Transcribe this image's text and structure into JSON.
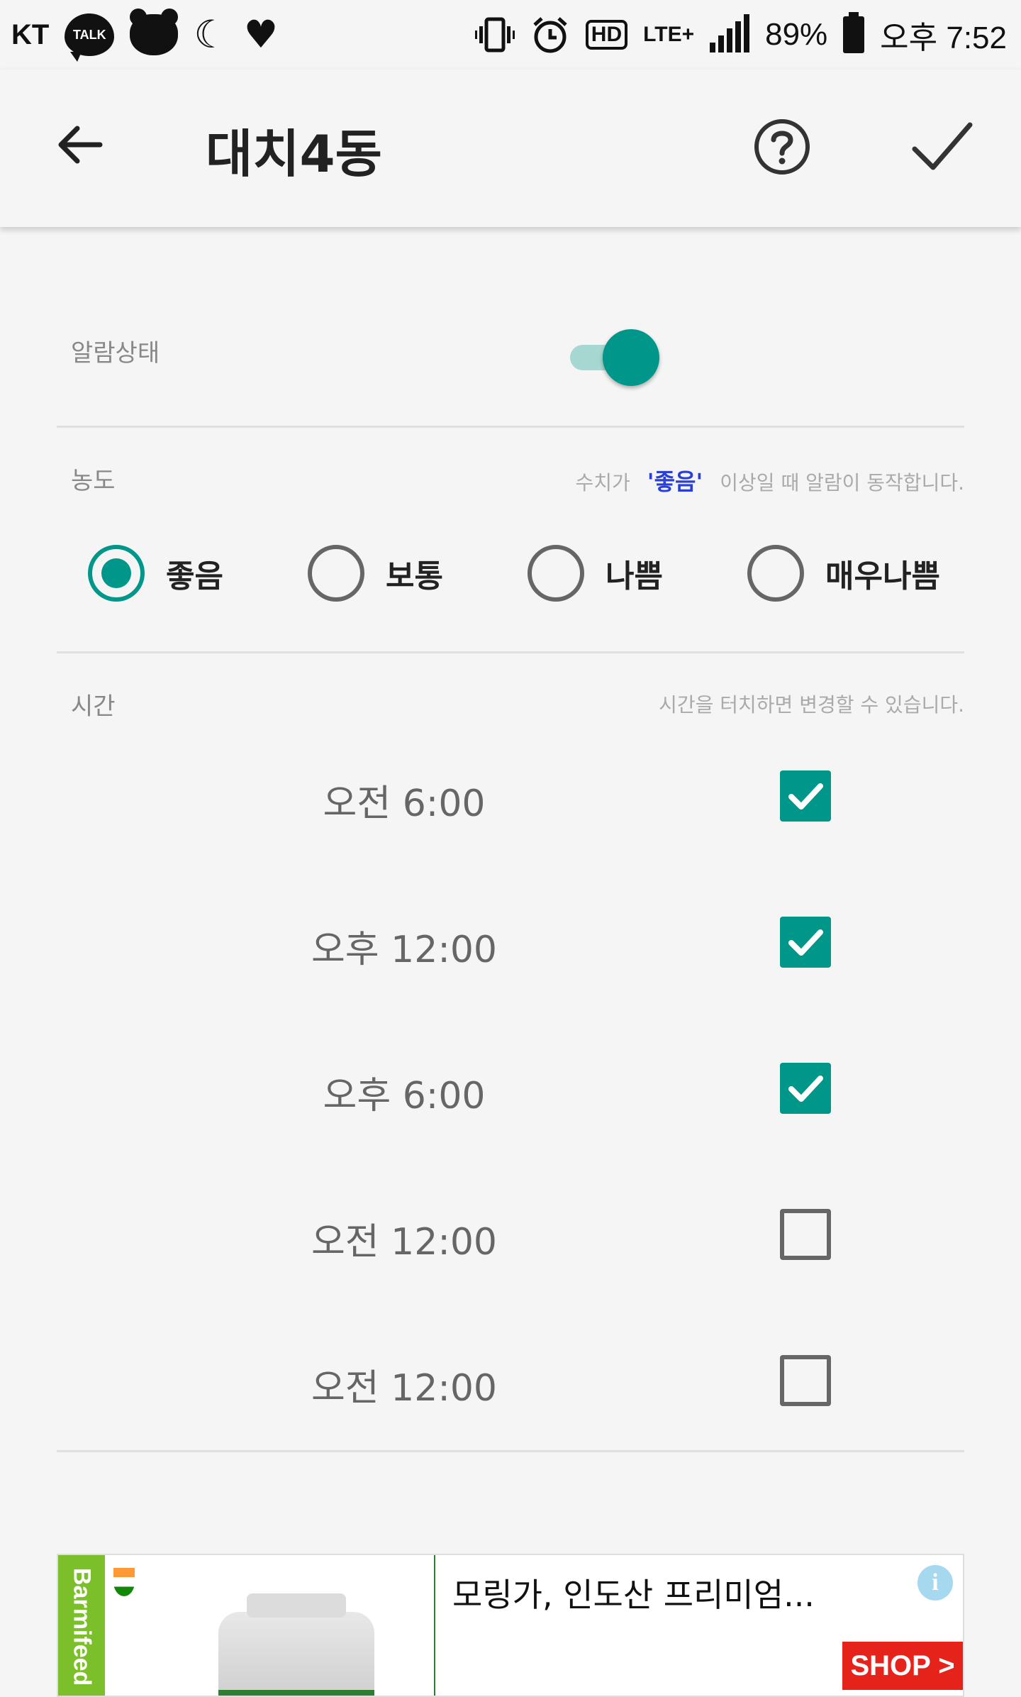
{
  "status_bar": {
    "carrier": "KT",
    "talk_badge": "TALK",
    "hd_label": "HD",
    "network": "LTE+",
    "battery_percent": "89%",
    "time": "오후 7:52",
    "icons": [
      "kakaotalk-icon",
      "bear-icon",
      "moon-icon",
      "heart-icon",
      "vibrate-icon",
      "alarm-clock-icon",
      "hd-icon",
      "lte-icon",
      "signal-icon",
      "battery-icon"
    ]
  },
  "app_bar": {
    "title": "대치4동",
    "icons": [
      "back-arrow-icon",
      "help-icon",
      "check-icon"
    ]
  },
  "alarm": {
    "label": "알람상태",
    "enabled": true
  },
  "concentration": {
    "label": "농도",
    "hint_prefix": "수치가",
    "hint_highlight": "'좋음'",
    "hint_suffix": "이상일 때 알람이 동작합니다.",
    "options": [
      {
        "label": "좋음",
        "selected": true
      },
      {
        "label": "보통",
        "selected": false
      },
      {
        "label": "나쁨",
        "selected": false
      },
      {
        "label": "매우나쁨",
        "selected": false
      }
    ]
  },
  "time": {
    "label": "시간",
    "hint": "시간을 터치하면 변경할 수 있습니다.",
    "rows": [
      {
        "time": "오전 6:00",
        "checked": true
      },
      {
        "time": "오후 12:00",
        "checked": true
      },
      {
        "time": "오후 6:00",
        "checked": true
      },
      {
        "time": "오전 12:00",
        "checked": false
      },
      {
        "time": "오전 12:00",
        "checked": false
      }
    ]
  },
  "ad": {
    "brand": "Barmifeed",
    "text": "모링가, 인도산 프리미엄...",
    "info_label": "i",
    "shop_label": "SHOP >"
  },
  "colors": {
    "accent": "#00968a",
    "switch_track": "#a7d7d1",
    "highlight_blue": "#2a3fd6",
    "shop_red": "#e5231b"
  }
}
